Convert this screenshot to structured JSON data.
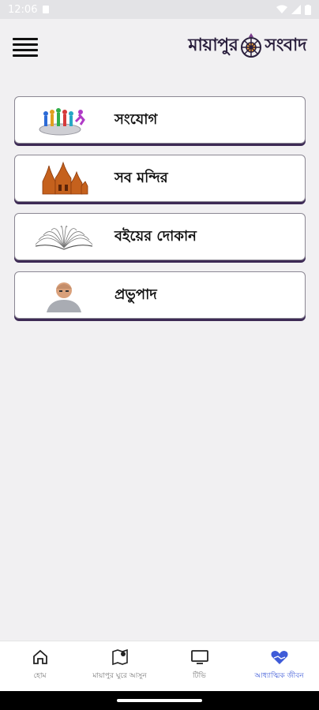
{
  "status_bar": {
    "time": "12:06"
  },
  "header": {
    "logo_left": "মায়াপুর",
    "logo_right": "সংবাদ"
  },
  "cards": [
    {
      "label": "সংযোগ",
      "icon": "people-connection-icon"
    },
    {
      "label": "সব মন্দির",
      "icon": "temple-icon"
    },
    {
      "label": "বইয়ের দোকান",
      "icon": "open-book-icon"
    },
    {
      "label": "প্রভুপাদ",
      "icon": "portrait-icon"
    }
  ],
  "bottom_nav": [
    {
      "label": "হোম",
      "icon": "home-icon",
      "active": false
    },
    {
      "label": "মায়াপুর ঘুরে আসুন",
      "icon": "map-pin-icon",
      "active": false
    },
    {
      "label": "টিভি",
      "icon": "tv-icon",
      "active": false
    },
    {
      "label": "আধ্যাত্মিক জীবন",
      "icon": "heart-hands-icon",
      "active": true
    }
  ],
  "colors": {
    "background": "#f1f0f2",
    "card_shadow": "#3d2a55",
    "active_nav": "#3e5bd8"
  }
}
